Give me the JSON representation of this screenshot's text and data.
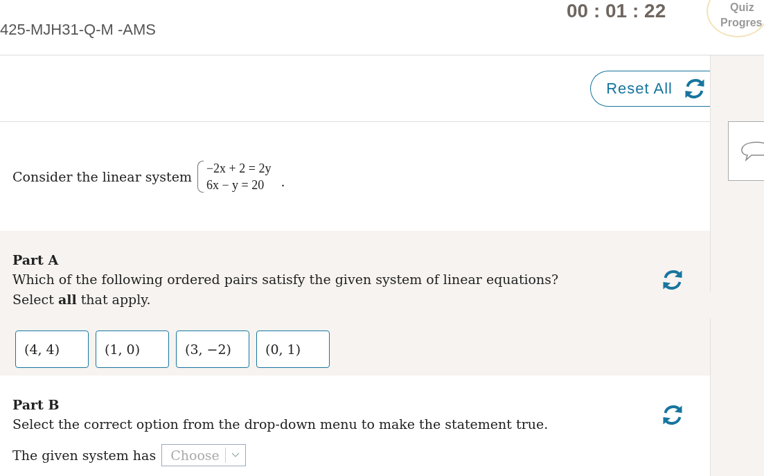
{
  "header": {
    "title": "425-MJH31-Q-M -AMS",
    "timer": "00 : 01 : 22",
    "quiz_progress": {
      "line_1": "Quiz",
      "line_2": "Progres"
    }
  },
  "reset_button": {
    "label": "Reset All"
  },
  "question": {
    "intro": "Consider the linear system",
    "equations": [
      "−2x + 2 = 2y",
      "6x − y = 20"
    ],
    "end": "."
  },
  "part_a": {
    "title": "Part A",
    "prompt": "Which of the following ordered pairs satisfy the given system of linear equations?",
    "instruction": "Select **all** that apply.",
    "options": [
      {
        "label": "(4, 4)",
        "selected": false
      },
      {
        "label": "(1, 0)",
        "selected": false
      },
      {
        "label": "(3, −2)",
        "selected": false
      },
      {
        "label": "(0, 1)",
        "selected": false
      }
    ]
  },
  "part_b": {
    "title": "Part B",
    "prompt": "Select the correct option from the drop-down menu to make the statement true.",
    "statement": "The given system has",
    "dropdown": {
      "placeholder": "Choose"
    }
  }
}
